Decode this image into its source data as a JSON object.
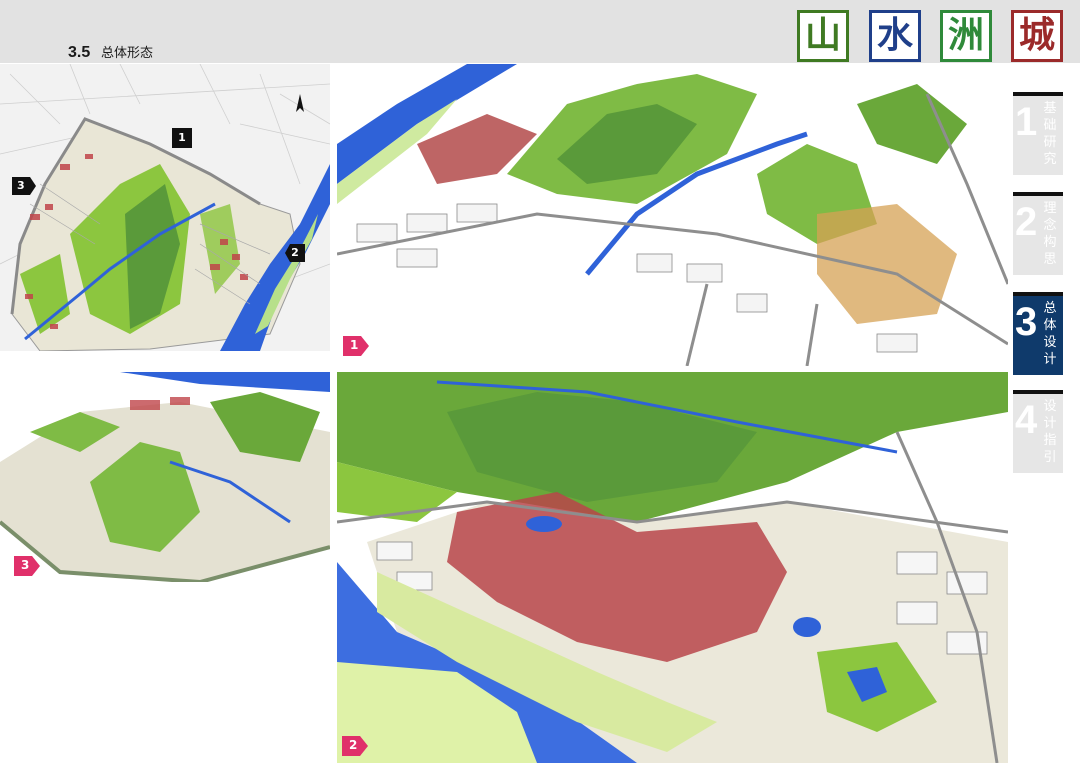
{
  "header": {
    "section_number": "3.5",
    "section_title": "总体形态"
  },
  "logo": {
    "chars": [
      "山",
      "水",
      "洲",
      "城"
    ],
    "colors": [
      "#3f7a22",
      "#1f3f8a",
      "#2f8a3a",
      "#9b2a2a"
    ]
  },
  "sidebar": {
    "tabs": [
      {
        "number": "1",
        "label": "基础研究",
        "active": false
      },
      {
        "number": "2",
        "label": "理念构思",
        "active": false
      },
      {
        "number": "3",
        "label": "总体设计",
        "active": true
      },
      {
        "number": "4",
        "label": "设计指引",
        "active": false
      }
    ]
  },
  "plan": {
    "markers": [
      "1",
      "2",
      "3"
    ]
  },
  "views": {
    "view1_badge": "1",
    "view2_badge": "2",
    "view3_badge": "3"
  },
  "colors": {
    "green": "#8cc63f",
    "dark_green": "#5a9a3a",
    "water": "#2f62d8",
    "red_blocks": "#c0454a",
    "badge_pink": "#e0306a"
  }
}
